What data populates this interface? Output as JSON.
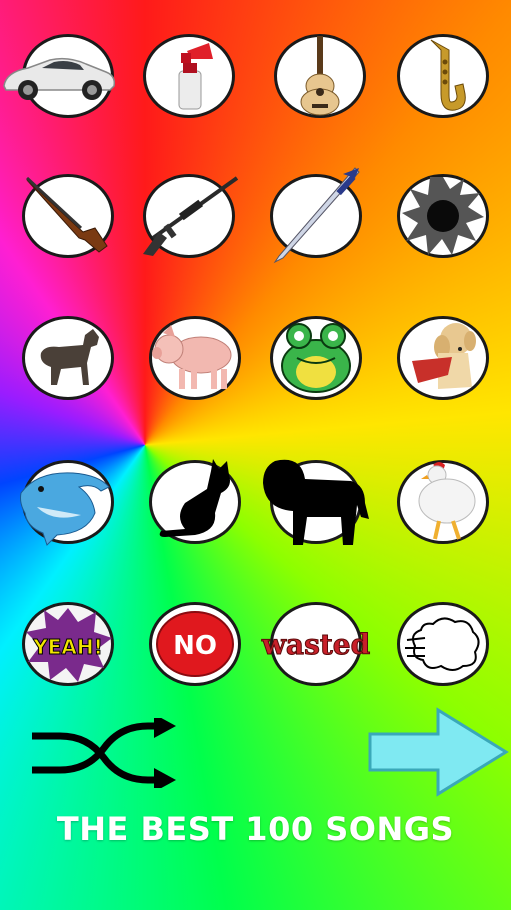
{
  "sound_buttons": [
    {
      "name": "car"
    },
    {
      "name": "air-horn"
    },
    {
      "name": "guitar"
    },
    {
      "name": "saxophone"
    },
    {
      "name": "rifle"
    },
    {
      "name": "sniper"
    },
    {
      "name": "sword"
    },
    {
      "name": "bullet-hole"
    },
    {
      "name": "wolf"
    },
    {
      "name": "pig"
    },
    {
      "name": "frog"
    },
    {
      "name": "dog"
    },
    {
      "name": "dolphin"
    },
    {
      "name": "cat"
    },
    {
      "name": "lion"
    },
    {
      "name": "chicken"
    },
    {
      "name": "yeah",
      "label": "YEAH!"
    },
    {
      "name": "no",
      "label": "NO"
    },
    {
      "name": "wasted",
      "label": "wasted"
    },
    {
      "name": "fart"
    }
  ],
  "footer": {
    "title": "THE BEST 100 SONGS"
  },
  "colors": {
    "shuffle": "#000000",
    "next_arrow": "#7fe9f2",
    "no_button": "#e0181e",
    "yeah_bg": "#7a2a8c",
    "yeah_text": "#f2e500",
    "wasted": "#c8202a"
  }
}
